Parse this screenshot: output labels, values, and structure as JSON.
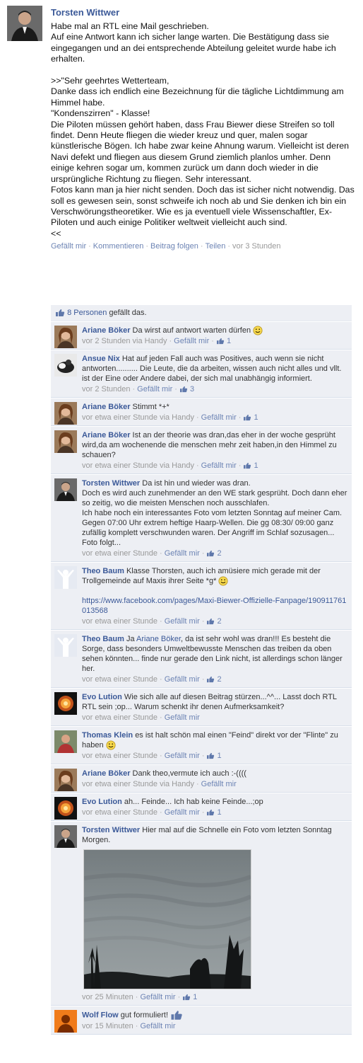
{
  "post": {
    "author": "Torsten Wittwer",
    "text": "Habe mal an RTL eine Mail geschrieben.\nAuf eine Antwort kann ich sicher lange warten. Die Bestätigung dass sie eingegangen und an dei entsprechende Abteilung geleitet wurde habe ich erhalten.\n\n>>\"Sehr geehrtes Wetterteam,\nDanke dass ich endlich eine Bezeichnung für die tägliche Lichtdimmung am Himmel habe.\n\"Kondenszirren\" - Klasse!\nDie Piloten müssen gehört haben, dass Frau Biewer diese Streifen so toll findet. Denn Heute fliegen die wieder kreuz und quer, malen sogar künstlerische Bögen. Ich habe zwar keine Ahnung warum. Vielleicht ist deren Navi defekt und fliegen aus diesem Grund ziemlich planlos umher. Denn einige kehren sogar um, kommen zurück um dann doch wieder in die ursprüngliche Richtung zu fliegen. Sehr interessant.\nFotos kann man ja hier nicht senden. Doch das ist sicher nicht notwendig. Das soll es gewesen sein, sonst schweife ich noch ab und Sie denken ich bin ein Verschwörungstheoretiker. Wie es ja eventuell viele Wissenschaftler, Ex-Piloten und auch einige Politiker weltweit vielleicht auch sind.\n<<",
    "actions": {
      "like": "Gefällt mir",
      "comment": "Kommentieren",
      "follow": "Beitrag folgen",
      "share": "Teilen",
      "time": "vor 3 Stunden"
    }
  },
  "likes": {
    "people": "8 Personen",
    "suffix": "gefällt das."
  },
  "comments": [
    {
      "name": "Ariane Böker",
      "text": "Da wirst auf antwort warten dürfen",
      "time": "vor 2 Stunden via Handy",
      "like": "Gefällt mir",
      "count": "1"
    },
    {
      "name": "Ansue Nix",
      "text": "Hat auf jeden Fall auch was Positives, auch wenn sie nicht antworten.......... Die Leute, die da arbeiten, wissen auch nicht alles und vllt. ist der Eine oder Andere dabei, der sich mal unabhängig informiert.",
      "time": "vor 2 Stunden",
      "like": "Gefällt mir",
      "count": "3"
    },
    {
      "name": "Ariane Böker",
      "text": "Stimmt *+*",
      "time": "vor etwa einer Stunde via Handy",
      "like": "Gefällt mir",
      "count": "1"
    },
    {
      "name": "Ariane Böker",
      "text": "Ist an der theorie was dran,das eher in der woche gesprüht wird,da am wochenende die menschen mehr zeit haben,in den Himmel zu schauen?",
      "time": "vor etwa einer Stunde via Handy",
      "like": "Gefällt mir",
      "count": "1"
    },
    {
      "name": "Torsten Wittwer",
      "text": "Da ist hin und wieder was dran.\nDoch es wird auch zunehmender an den WE stark gesprüht. Doch dann eher so zeitig, wo die meisten Menschen noch ausschlafen.\nIch habe noch ein interessantes Foto vom letzten Sonntag auf meiner Cam. Gegen 07:00 Uhr extrem heftige Haarp-Wellen. Die gg 08:30/ 09:00 ganz zufällig komplett verschwunden waren. Der Angriff im Schlaf sozusagen...\nFoto folgt...",
      "time": "vor etwa einer Stunde",
      "like": "Gefällt mir",
      "count": "2"
    },
    {
      "name": "Theo Baum",
      "text": "Klasse Thorsten, auch ich amüsiere mich gerade mit der Trollgemeinde auf Maxis ihrer Seite *g*",
      "link": "https://www.facebook.com/pages/Maxi-Biewer-Offizielle-Fanpage/190911761013568",
      "time": "vor etwa einer Stunde",
      "like": "Gefällt mir",
      "count": "2"
    },
    {
      "name": "Theo Baum",
      "prefix": "Ja",
      "mention": "Ariane Böker",
      "text": ", da ist sehr wohl was dran!!! Es besteht die Sorge, dass besonders Umweltbewusste Menschen das treiben da oben sehen könnten... finde nur gerade den Link nicht, ist allerdings schon länger her.",
      "time": "vor etwa einer Stunde",
      "like": "Gefällt mir",
      "count": "2"
    },
    {
      "name": "Evo Lution",
      "text": "Wie sich alle auf diesen Beitrag stürzen...^^... Lasst doch RTL RTL sein ;op... Warum schenkt ihr denen Aufmerksamkeit?",
      "time": "vor etwa einer Stunde",
      "like": "Gefällt mir"
    },
    {
      "name": "Thomas Klein",
      "text": "es ist halt schön mal einen \"Feind\" direkt vor der \"Flinte\" zu haben",
      "time": "vor etwa einer Stunde",
      "like": "Gefällt mir",
      "count": "1"
    },
    {
      "name": "Ariane Böker",
      "text": "Dank theo,vermute ich auch :-((((",
      "time": "vor etwa einer Stunde via Handy",
      "like": "Gefällt mir"
    },
    {
      "name": "Evo Lution",
      "text": "ah... Feinde... Ich hab keine Feinde...;op",
      "time": "vor etwa einer Stunde",
      "like": "Gefällt mir",
      "count": "1"
    },
    {
      "name": "Torsten Wittwer",
      "text": "Hier mal auf die Schnelle ein Foto vom letzten Sonntag Morgen.",
      "time": "vor 25 Minuten",
      "like": "Gefällt mir",
      "count": "1"
    },
    {
      "name": "Wolf Flow",
      "text": "gut formuliert!",
      "time": "vor 15 Minuten",
      "like": "Gefällt mir"
    }
  ],
  "colors": {
    "link": "#3b5998",
    "feedback_bg": "#edeff4",
    "meta": "#999999"
  }
}
